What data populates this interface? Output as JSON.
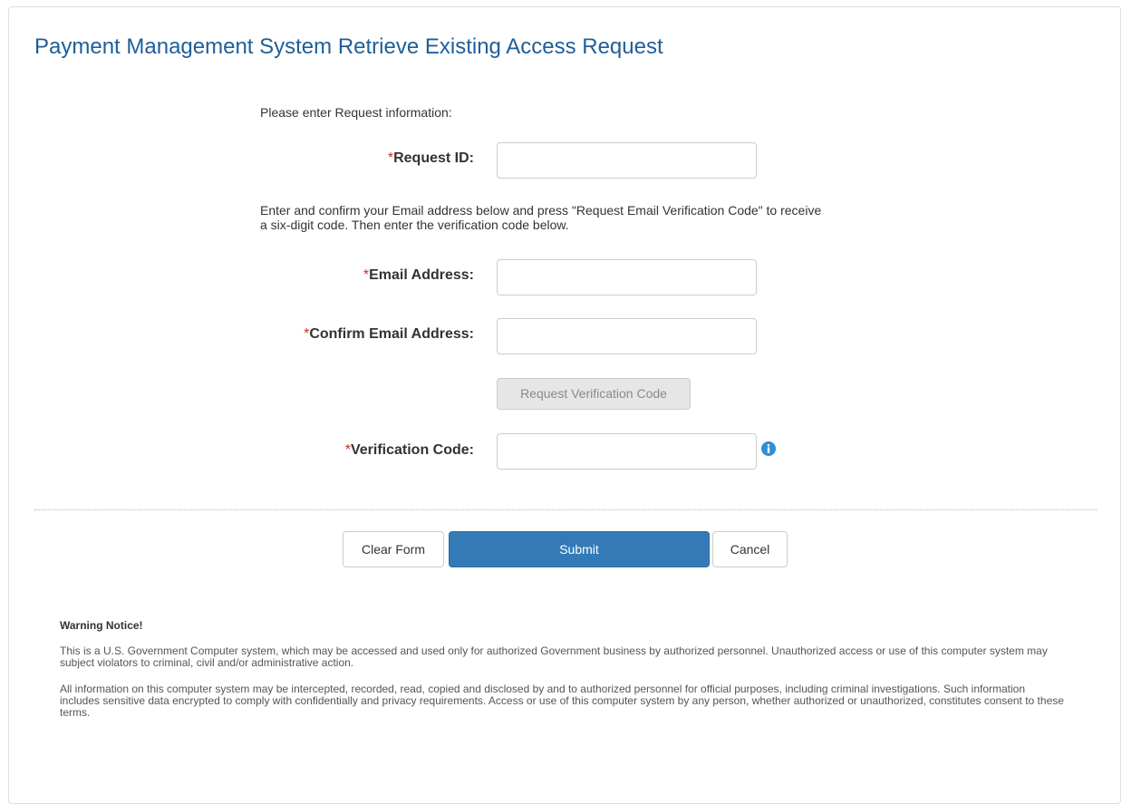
{
  "header": {
    "title": "Payment Management System Retrieve Existing Access Request"
  },
  "form": {
    "intro": "Please enter Request information:",
    "required_marker": "*",
    "request_id_label": "Request ID:",
    "request_id_value": "",
    "email_instructions": "Enter and confirm your Email address below and press \"Request Email Verification Code\" to receive a six-digit code. Then enter the verification code below.",
    "email_label": "Email Address:",
    "email_value": "",
    "confirm_email_label": "Confirm Email Address:",
    "confirm_email_value": "",
    "request_code_button": "Request Verification Code",
    "verification_code_label": "Verification Code:",
    "verification_code_value": "",
    "info_icon": "info-circle-icon"
  },
  "actions": {
    "clear_label": "Clear Form",
    "submit_label": "Submit",
    "cancel_label": "Cancel"
  },
  "warning": {
    "title": "Warning Notice!",
    "paragraph1": "This is a U.S. Government Computer system, which may be accessed and used only for authorized Government business by authorized personnel. Unauthorized access or use of this computer system may subject violators to criminal, civil and/or administrative action.",
    "paragraph2": "All information on this computer system may be intercepted, recorded, read, copied and disclosed by and to authorized personnel for official purposes, including criminal investigations. Such information includes sensitive data encrypted to comply with confidentially and privacy requirements. Access or use of this computer system by any person, whether authorized or unauthorized, constitutes consent to these terms."
  },
  "colors": {
    "title": "#1f5e99",
    "primary_button": "#337ab7",
    "required_marker": "#c9302c",
    "info_icon": "#2d8fd5"
  }
}
